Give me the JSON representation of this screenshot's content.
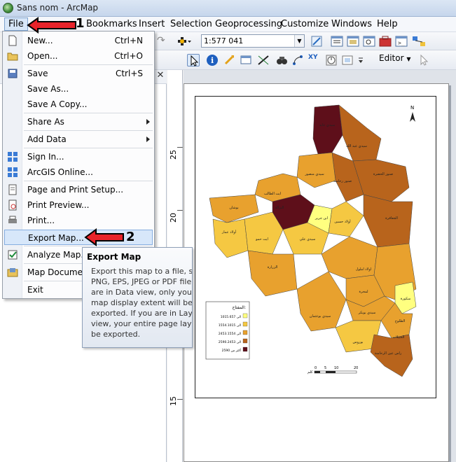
{
  "window": {
    "title": "Sans nom - ArcMap",
    "app_icon": "arcmap-globe-icon"
  },
  "menubar": {
    "items": [
      "File",
      "Bookmarks",
      "Insert",
      "Selection",
      "Geoprocessing",
      "Customize",
      "Windows",
      "Help"
    ]
  },
  "toolbar": {
    "scale": "1:577 041",
    "editor_label": "Editor"
  },
  "file_menu": {
    "items": [
      {
        "label": "New...",
        "shortcut": "Ctrl+N",
        "icon": "new-document-icon"
      },
      {
        "label": "Open...",
        "shortcut": "Ctrl+O",
        "icon": "open-folder-icon"
      },
      {
        "label": "Save",
        "shortcut": "Ctrl+S",
        "icon": "save-icon"
      },
      {
        "label": "Save As...",
        "shortcut": ""
      },
      {
        "label": "Save A Copy...",
        "shortcut": ""
      },
      {
        "label": "Share As",
        "submenu": true
      },
      {
        "label": "Add Data",
        "submenu": true
      },
      {
        "label": "Sign In...",
        "icon": "sign-in-icon"
      },
      {
        "label": "ArcGIS Online...",
        "icon": "arcgis-online-icon"
      },
      {
        "label": "Page and Print Setup...",
        "icon": "page-setup-icon"
      },
      {
        "label": "Print Preview...",
        "icon": "print-preview-icon"
      },
      {
        "label": "Print...",
        "icon": "print-icon"
      },
      {
        "label": "Export Map...",
        "highlighted": true
      },
      {
        "label": "Analyze Map...",
        "icon": "analyze-map-icon"
      },
      {
        "label": "Map Document",
        "icon": "map-document-icon"
      },
      {
        "label": "Exit"
      }
    ]
  },
  "tooltip": {
    "title": "Export Map",
    "body": "Export this map to a file, su\nPNG, EPS, JPEG or PDF file.\nare in Data view, only your\nmap display extent will be\nexported. If you are in Layo\nview, your entire page layo\nbe exported."
  },
  "annotations": {
    "step1": "1",
    "step2": "2"
  },
  "ruler": {
    "labels": [
      "25",
      "20",
      "15"
    ]
  },
  "map": {
    "north_label": "N",
    "legend_title": "المفتاح:",
    "legend_items": [
      {
        "label": "1015.657 الى",
        "color": "#ffff80"
      },
      {
        "label": "1554.1015 الى",
        "color": "#f5c842"
      },
      {
        "label": "2453.1554 الى",
        "color": "#e8a12e"
      },
      {
        "label": "2590.2453 الى",
        "color": "#b8641c"
      },
      {
        "label": "أكثر من 2590",
        "color": "#5e0f1a"
      }
    ],
    "scale_labels": [
      "0",
      "5",
      "10",
      "20"
    ],
    "scale_unit": "كلم",
    "places": [
      "سيدي عابد",
      "سيدي عبد الله",
      "صنور الحضرة",
      "صنور رحامنة",
      "سيدي منصور",
      "ايت الطالب",
      "بوشان",
      "أولاد عمار",
      "ايت حمو",
      "ابن جرير",
      "أولاد حسين",
      "الجعافرة",
      "سيدي علي",
      "الزرارة",
      "اولاد املول",
      "لمحرة",
      "سكورة",
      "سيدي بوعثمان",
      "سيدي بويكر",
      "الطلوح",
      "الجبيلات",
      "بوروس",
      "راس عين الرحامنة",
      "النزالة"
    ]
  }
}
